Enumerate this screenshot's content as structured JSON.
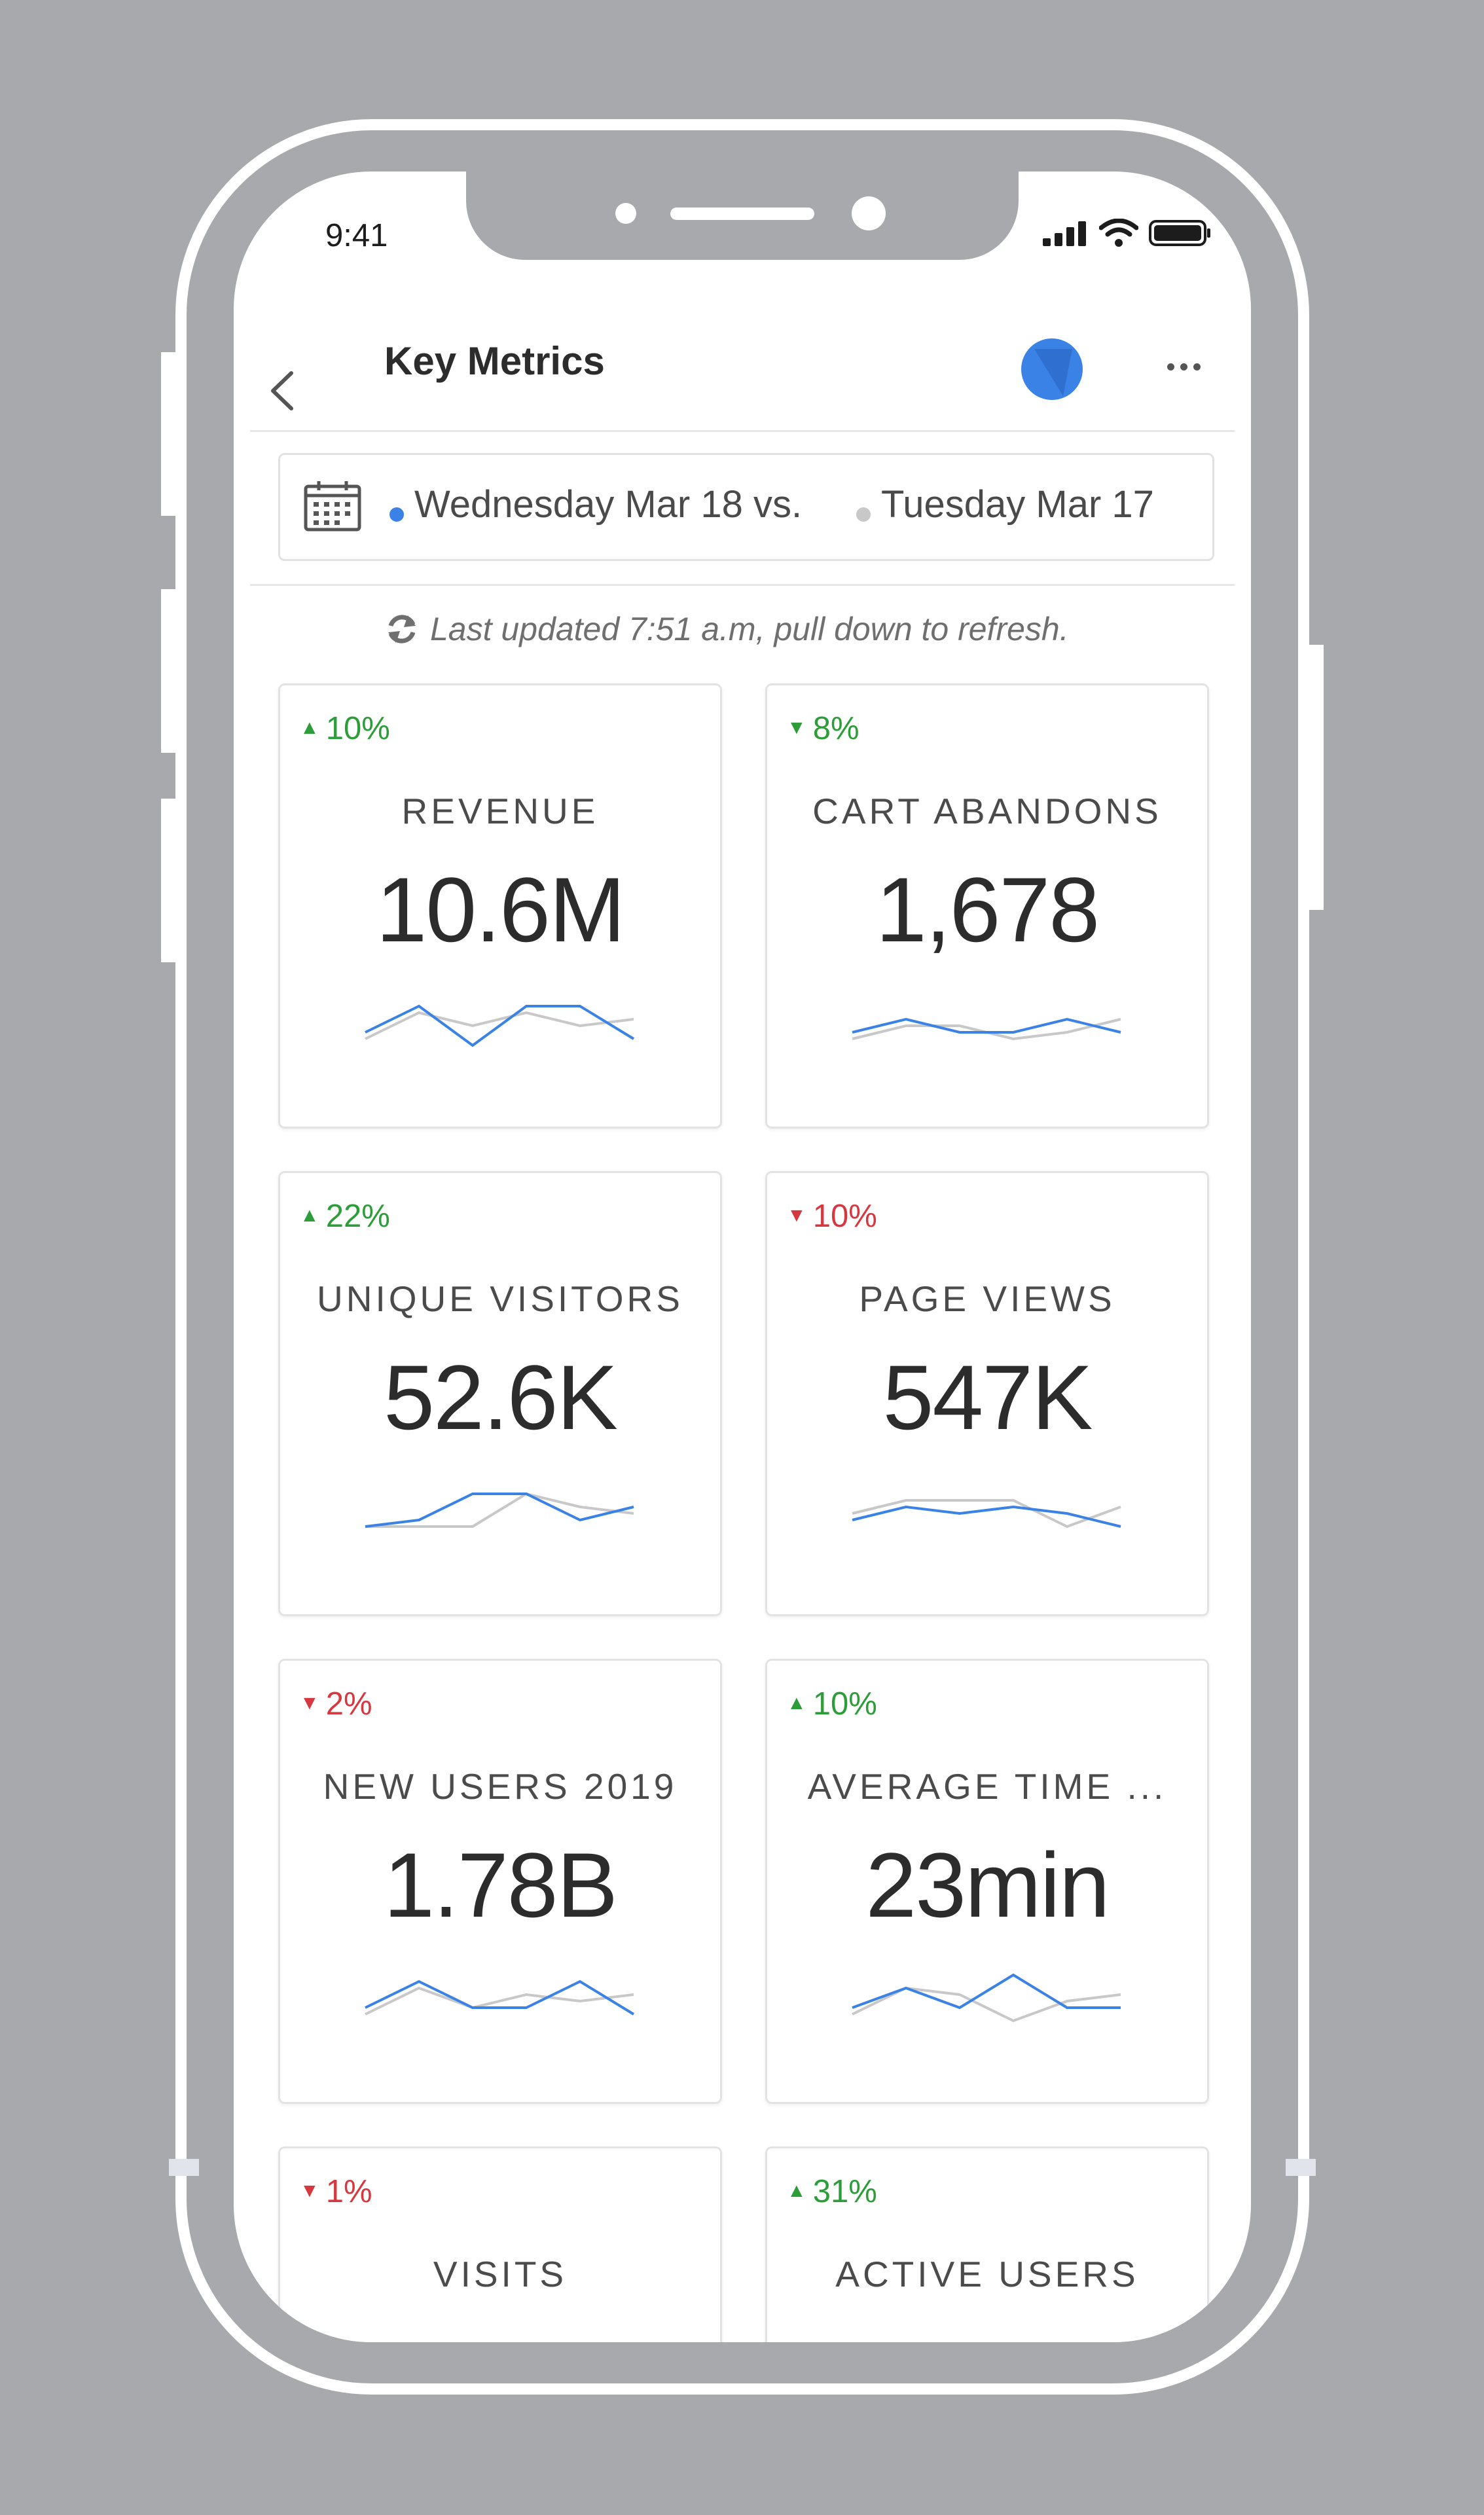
{
  "status_bar": {
    "time": "9:41"
  },
  "header": {
    "title": "Key Metrics"
  },
  "date_range": {
    "current": "Wednesday Mar 18 vs.",
    "compare": "Tuesday Mar 17"
  },
  "refresh": {
    "text": "Last updated 7:51 a.m, pull down to refresh."
  },
  "colors": {
    "primary": "#3b82e6",
    "comparison": "#c8c8c8",
    "up": "#2d9d3a",
    "down": "#d7373f"
  },
  "metrics": [
    {
      "title": "REVENUE",
      "value": "10.6M",
      "change": "10%",
      "direction": "up",
      "change_color": "#2d9d3a",
      "spark_current": [
        0.4,
        0.8,
        0.2,
        0.8,
        0.8,
        0.3
      ],
      "spark_previous": [
        0.3,
        0.7,
        0.5,
        0.7,
        0.5,
        0.6
      ]
    },
    {
      "title": "CART ABANDONS",
      "value": "1,678",
      "change": "8%",
      "direction": "down",
      "change_color": "#2d9d3a",
      "spark_current": [
        0.4,
        0.6,
        0.4,
        0.4,
        0.6,
        0.4
      ],
      "spark_previous": [
        0.3,
        0.5,
        0.5,
        0.3,
        0.4,
        0.6
      ]
    },
    {
      "title": "UNIQUE VISITORS",
      "value": "52.6K",
      "change": "22%",
      "direction": "up",
      "change_color": "#2d9d3a",
      "spark_current": [
        0.3,
        0.4,
        0.8,
        0.8,
        0.4,
        0.6
      ],
      "spark_previous": [
        0.3,
        0.3,
        0.3,
        0.8,
        0.6,
        0.5
      ]
    },
    {
      "title": "PAGE VIEWS",
      "value": "547K",
      "change": "10%",
      "direction": "down",
      "change_color": "#d7373f",
      "spark_current": [
        0.4,
        0.6,
        0.5,
        0.6,
        0.5,
        0.3
      ],
      "spark_previous": [
        0.5,
        0.7,
        0.7,
        0.7,
        0.3,
        0.6
      ]
    },
    {
      "title": "NEW USERS 2019",
      "value": "1.78B",
      "change": "2%",
      "direction": "down",
      "change_color": "#d7373f",
      "spark_current": [
        0.4,
        0.8,
        0.4,
        0.4,
        0.8,
        0.3
      ],
      "spark_previous": [
        0.3,
        0.7,
        0.4,
        0.6,
        0.5,
        0.6
      ]
    },
    {
      "title": "AVERAGE TIME ...",
      "value": "23min",
      "change": "10%",
      "direction": "up",
      "change_color": "#2d9d3a",
      "spark_current": [
        0.4,
        0.7,
        0.4,
        0.9,
        0.4,
        0.4
      ],
      "spark_previous": [
        0.3,
        0.7,
        0.6,
        0.2,
        0.5,
        0.6
      ]
    },
    {
      "title": "VISITS",
      "value": "",
      "change": "1%",
      "direction": "down",
      "change_color": "#d7373f",
      "spark_current": [],
      "spark_previous": []
    },
    {
      "title": "ACTIVE USERS",
      "value": "",
      "change": "31%",
      "direction": "up",
      "change_color": "#2d9d3a",
      "spark_current": [],
      "spark_previous": []
    }
  ]
}
